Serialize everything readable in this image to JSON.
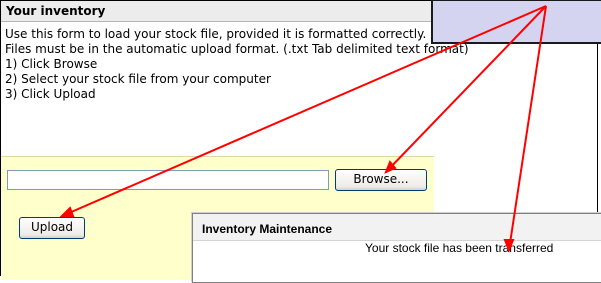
{
  "panel": {
    "title": "Your inventory",
    "instructions": [
      "Use this form to load your stock file, provided it is formatted correctly.",
      "Files must be in the automatic upload format. (.txt Tab delimited text format)",
      "1) Click Browse",
      "2) Select your stock file from your computer",
      "3) Click Upload"
    ]
  },
  "form": {
    "file_value": "",
    "browse_label": "Browse...",
    "upload_label": "Upload"
  },
  "popup": {
    "title": "Inventory Maintenance",
    "message": "Your stock file has been transferred"
  },
  "annotations": {
    "arrow_color": "#ff0000"
  }
}
